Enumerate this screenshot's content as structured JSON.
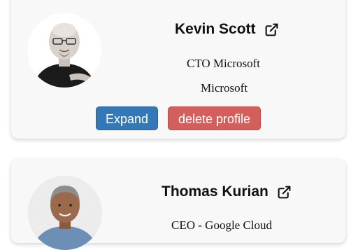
{
  "profiles": [
    {
      "name": "Kevin Scott",
      "title": "CTO Microsoft",
      "company": "Microsoft",
      "expand_label": "Expand",
      "delete_label": "delete profile"
    },
    {
      "name": "Thomas Kurian",
      "title": "CEO - Google Cloud"
    }
  ],
  "colors": {
    "card_bg": "#f8f8f8",
    "expand_button": "#3578b7",
    "delete_button": "#d25f5b",
    "text": "#111111"
  },
  "icons": {
    "external_link": "external-link-icon"
  }
}
